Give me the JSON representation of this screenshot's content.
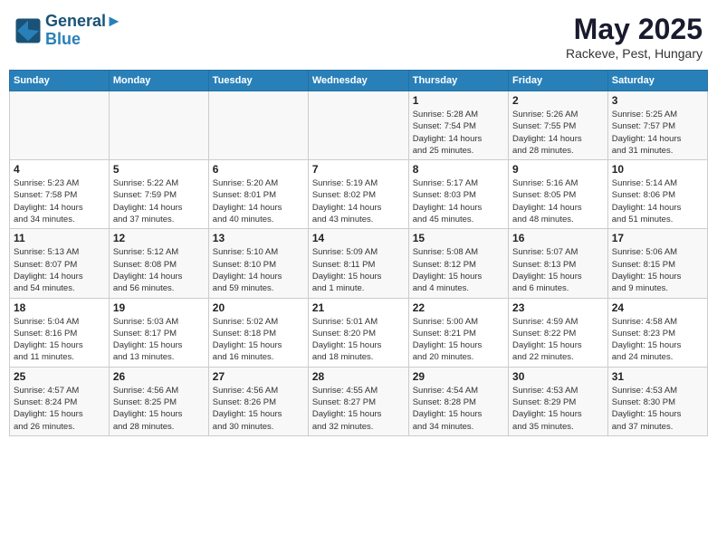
{
  "header": {
    "logo_line1": "General",
    "logo_line2": "Blue",
    "month": "May 2025",
    "location": "Rackeve, Pest, Hungary"
  },
  "weekdays": [
    "Sunday",
    "Monday",
    "Tuesday",
    "Wednesday",
    "Thursday",
    "Friday",
    "Saturday"
  ],
  "weeks": [
    [
      {
        "day": "",
        "info": ""
      },
      {
        "day": "",
        "info": ""
      },
      {
        "day": "",
        "info": ""
      },
      {
        "day": "",
        "info": ""
      },
      {
        "day": "1",
        "info": "Sunrise: 5:28 AM\nSunset: 7:54 PM\nDaylight: 14 hours\nand 25 minutes."
      },
      {
        "day": "2",
        "info": "Sunrise: 5:26 AM\nSunset: 7:55 PM\nDaylight: 14 hours\nand 28 minutes."
      },
      {
        "day": "3",
        "info": "Sunrise: 5:25 AM\nSunset: 7:57 PM\nDaylight: 14 hours\nand 31 minutes."
      }
    ],
    [
      {
        "day": "4",
        "info": "Sunrise: 5:23 AM\nSunset: 7:58 PM\nDaylight: 14 hours\nand 34 minutes."
      },
      {
        "day": "5",
        "info": "Sunrise: 5:22 AM\nSunset: 7:59 PM\nDaylight: 14 hours\nand 37 minutes."
      },
      {
        "day": "6",
        "info": "Sunrise: 5:20 AM\nSunset: 8:01 PM\nDaylight: 14 hours\nand 40 minutes."
      },
      {
        "day": "7",
        "info": "Sunrise: 5:19 AM\nSunset: 8:02 PM\nDaylight: 14 hours\nand 43 minutes."
      },
      {
        "day": "8",
        "info": "Sunrise: 5:17 AM\nSunset: 8:03 PM\nDaylight: 14 hours\nand 45 minutes."
      },
      {
        "day": "9",
        "info": "Sunrise: 5:16 AM\nSunset: 8:05 PM\nDaylight: 14 hours\nand 48 minutes."
      },
      {
        "day": "10",
        "info": "Sunrise: 5:14 AM\nSunset: 8:06 PM\nDaylight: 14 hours\nand 51 minutes."
      }
    ],
    [
      {
        "day": "11",
        "info": "Sunrise: 5:13 AM\nSunset: 8:07 PM\nDaylight: 14 hours\nand 54 minutes."
      },
      {
        "day": "12",
        "info": "Sunrise: 5:12 AM\nSunset: 8:08 PM\nDaylight: 14 hours\nand 56 minutes."
      },
      {
        "day": "13",
        "info": "Sunrise: 5:10 AM\nSunset: 8:10 PM\nDaylight: 14 hours\nand 59 minutes."
      },
      {
        "day": "14",
        "info": "Sunrise: 5:09 AM\nSunset: 8:11 PM\nDaylight: 15 hours\nand 1 minute."
      },
      {
        "day": "15",
        "info": "Sunrise: 5:08 AM\nSunset: 8:12 PM\nDaylight: 15 hours\nand 4 minutes."
      },
      {
        "day": "16",
        "info": "Sunrise: 5:07 AM\nSunset: 8:13 PM\nDaylight: 15 hours\nand 6 minutes."
      },
      {
        "day": "17",
        "info": "Sunrise: 5:06 AM\nSunset: 8:15 PM\nDaylight: 15 hours\nand 9 minutes."
      }
    ],
    [
      {
        "day": "18",
        "info": "Sunrise: 5:04 AM\nSunset: 8:16 PM\nDaylight: 15 hours\nand 11 minutes."
      },
      {
        "day": "19",
        "info": "Sunrise: 5:03 AM\nSunset: 8:17 PM\nDaylight: 15 hours\nand 13 minutes."
      },
      {
        "day": "20",
        "info": "Sunrise: 5:02 AM\nSunset: 8:18 PM\nDaylight: 15 hours\nand 16 minutes."
      },
      {
        "day": "21",
        "info": "Sunrise: 5:01 AM\nSunset: 8:20 PM\nDaylight: 15 hours\nand 18 minutes."
      },
      {
        "day": "22",
        "info": "Sunrise: 5:00 AM\nSunset: 8:21 PM\nDaylight: 15 hours\nand 20 minutes."
      },
      {
        "day": "23",
        "info": "Sunrise: 4:59 AM\nSunset: 8:22 PM\nDaylight: 15 hours\nand 22 minutes."
      },
      {
        "day": "24",
        "info": "Sunrise: 4:58 AM\nSunset: 8:23 PM\nDaylight: 15 hours\nand 24 minutes."
      }
    ],
    [
      {
        "day": "25",
        "info": "Sunrise: 4:57 AM\nSunset: 8:24 PM\nDaylight: 15 hours\nand 26 minutes."
      },
      {
        "day": "26",
        "info": "Sunrise: 4:56 AM\nSunset: 8:25 PM\nDaylight: 15 hours\nand 28 minutes."
      },
      {
        "day": "27",
        "info": "Sunrise: 4:56 AM\nSunset: 8:26 PM\nDaylight: 15 hours\nand 30 minutes."
      },
      {
        "day": "28",
        "info": "Sunrise: 4:55 AM\nSunset: 8:27 PM\nDaylight: 15 hours\nand 32 minutes."
      },
      {
        "day": "29",
        "info": "Sunrise: 4:54 AM\nSunset: 8:28 PM\nDaylight: 15 hours\nand 34 minutes."
      },
      {
        "day": "30",
        "info": "Sunrise: 4:53 AM\nSunset: 8:29 PM\nDaylight: 15 hours\nand 35 minutes."
      },
      {
        "day": "31",
        "info": "Sunrise: 4:53 AM\nSunset: 8:30 PM\nDaylight: 15 hours\nand 37 minutes."
      }
    ]
  ]
}
